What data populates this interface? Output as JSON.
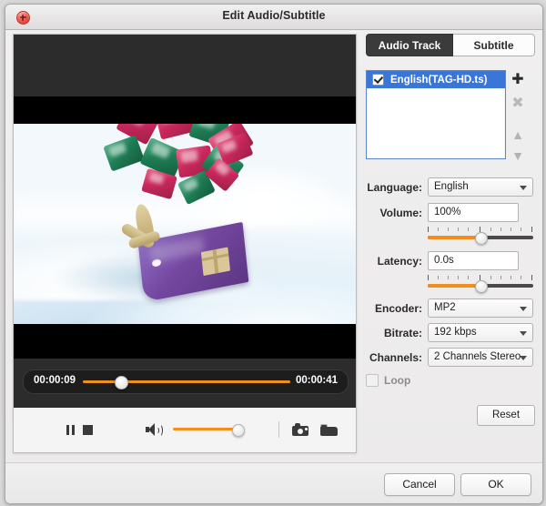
{
  "window": {
    "title": "Edit Audio/Subtitle",
    "close_icon": "close-icon"
  },
  "tabs": [
    {
      "label": "Audio Track",
      "active": true
    },
    {
      "label": "Subtitle",
      "active": false
    }
  ],
  "track_list": {
    "items": [
      {
        "label": "English(TAG-HD.ts)",
        "checked": true,
        "selected": true
      }
    ],
    "buttons": [
      {
        "name": "add-track",
        "glyph": "✚",
        "enabled": true
      },
      {
        "name": "remove-track",
        "glyph": "✖",
        "enabled": false
      },
      {
        "name": "move-up",
        "glyph": "▲",
        "enabled": false
      },
      {
        "name": "move-down",
        "glyph": "▼",
        "enabled": false
      }
    ]
  },
  "fields": {
    "language": {
      "label": "Language:",
      "value": "English"
    },
    "volume": {
      "label": "Volume:",
      "value": "100%",
      "slider_percent": 50
    },
    "latency": {
      "label": "Latency:",
      "value": "0.0s",
      "slider_percent": 50
    },
    "encoder": {
      "label": "Encoder:",
      "value": "MP2"
    },
    "bitrate": {
      "label": "Bitrate:",
      "value": "192 kbps"
    },
    "channels": {
      "label": "Channels:",
      "value": "2 Channels Stereo"
    },
    "loop": {
      "label": "Loop",
      "checked": false
    }
  },
  "reset_button": "Reset",
  "player": {
    "current_time": "00:00:09",
    "total_time": "00:00:41",
    "progress_percent": 27,
    "volume_percent": 92,
    "controls": [
      {
        "name": "pause-button",
        "icon": "pause-icon"
      },
      {
        "name": "stop-button",
        "icon": "stop-icon"
      },
      {
        "name": "volume-button",
        "icon": "speaker-icon"
      },
      {
        "name": "snapshot-button",
        "icon": "camera-icon"
      },
      {
        "name": "open-folder-button",
        "icon": "folder-icon"
      }
    ]
  },
  "footer": {
    "cancel": "Cancel",
    "ok": "OK"
  }
}
